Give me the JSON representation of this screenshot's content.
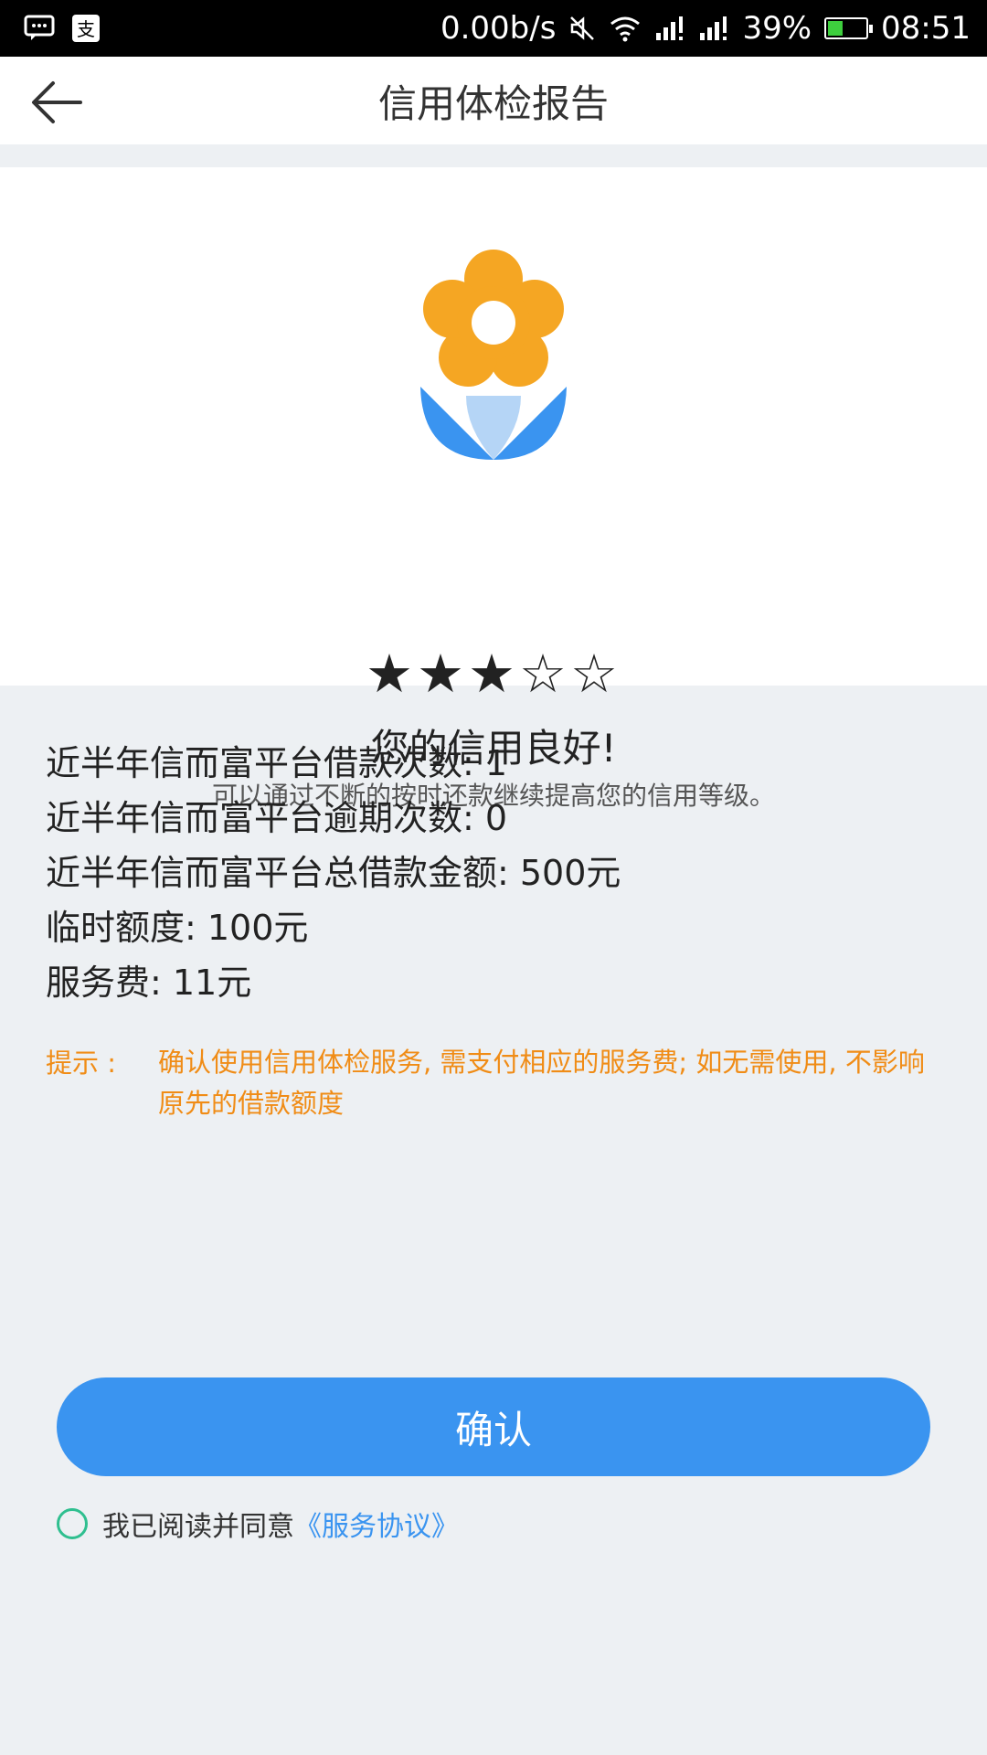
{
  "status_bar": {
    "speed": "0.00b/s",
    "battery": "39%",
    "battery_level": 0.39,
    "time": "08:51",
    "icons": [
      "message-icon",
      "alipay-icon",
      "mute-icon",
      "wifi-icon",
      "signal-icon",
      "signal-icon",
      "battery-icon"
    ]
  },
  "header": {
    "title": "信用体检报告",
    "back_icon": "back-arrow-icon"
  },
  "report": {
    "rating": 3,
    "rating_max": 5,
    "stars": "★★★☆☆",
    "headline": "您的信用良好!",
    "subtext": "可以通过不断的按时还款继续提高您的信用等级。"
  },
  "stats": [
    "近半年信而富平台借款次数: 1",
    "近半年信而富平台逾期次数: 0",
    "近半年信而富平台总借款金额: 500元",
    "临时额度: 100元",
    "服务费: 11元"
  ],
  "tip": {
    "label": "提示 :",
    "text": "确认使用信用体检服务, 需支付相应的服务费; 如无需使用, 不影响原先的借款额度"
  },
  "confirm_button": "确认",
  "agreement": {
    "text": "我已阅读并同意",
    "link": "《服务协议》"
  },
  "colors": {
    "accent": "#3a94f0",
    "tip": "#f08c16",
    "radio": "#2fbf8f",
    "flower_petal": "#f5a623",
    "flower_leaf": "#3a94f0"
  }
}
